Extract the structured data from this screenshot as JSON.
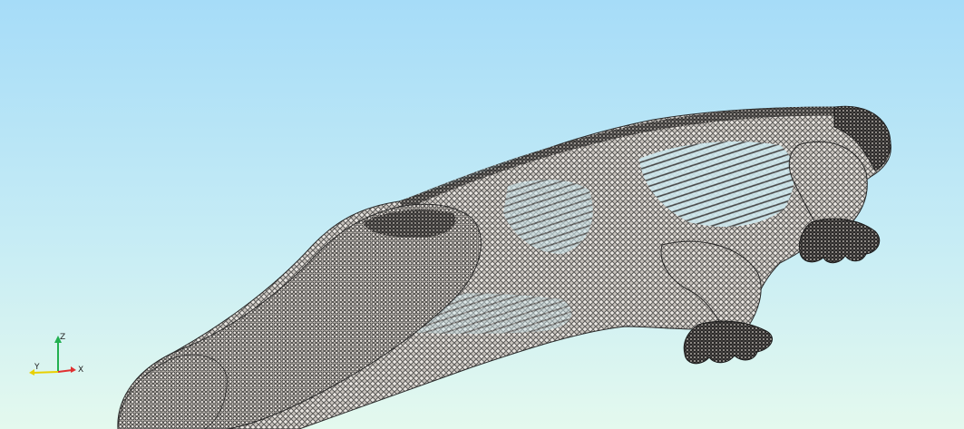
{
  "viewer": {
    "background_top": "#a6dcf8",
    "background_bottom": "#e4f9ee",
    "mesh_fill": "#b9b4ae",
    "mesh_line": "#2a2a2a",
    "model": "crocodile-wireframe-mesh"
  },
  "triad": {
    "x_label": "X",
    "y_label": "Y",
    "z_label": "Z",
    "x_color": "#e03030",
    "y_color": "#e8d000",
    "z_color": "#22b050"
  }
}
